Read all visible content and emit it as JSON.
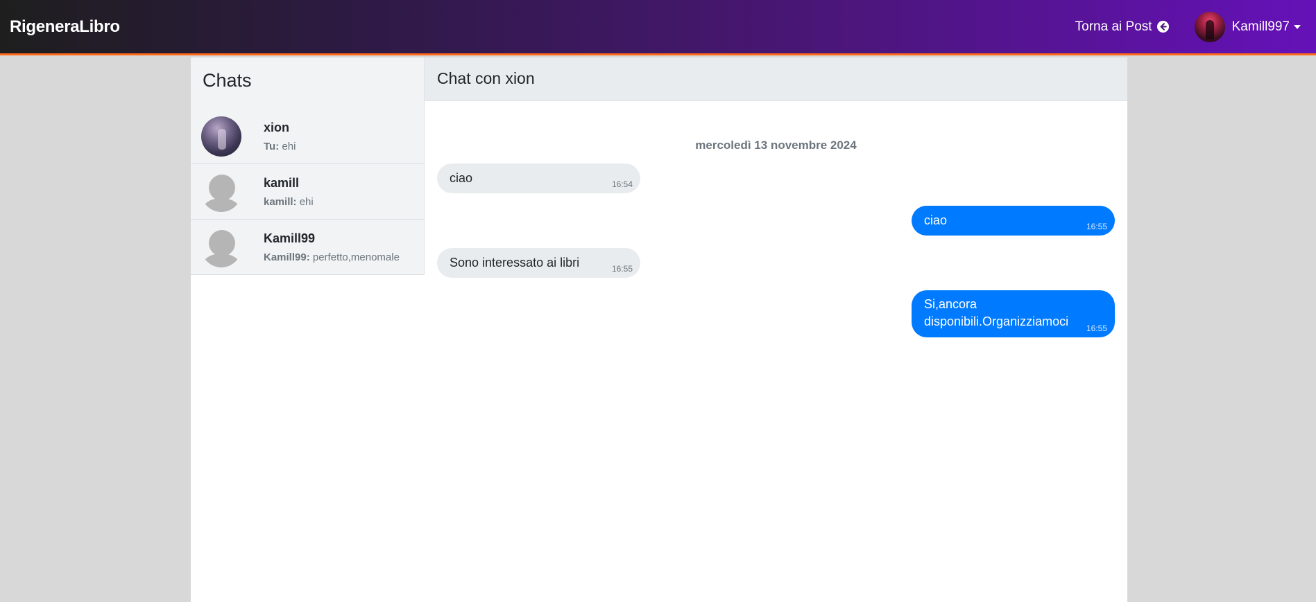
{
  "navbar": {
    "brand": "RigeneraLibro",
    "back_label": "Torna ai Post",
    "username": "Kamill997"
  },
  "sidebar": {
    "title": "Chats",
    "chats": [
      {
        "name": "xion",
        "sender": "Tu:",
        "preview": "ehi",
        "avatar": "photo"
      },
      {
        "name": "kamill",
        "sender": "kamill:",
        "preview": "ehi",
        "avatar": "default-user-icon"
      },
      {
        "name": "Kamill99",
        "sender": "Kamill99:",
        "preview": "perfetto,menomale",
        "avatar": "default-user-icon"
      }
    ]
  },
  "conversation": {
    "title": "Chat con xion",
    "date_separator": "mercoledì 13 novembre 2024",
    "messages": [
      {
        "direction": "incoming",
        "text": "ciao",
        "time": "16:54"
      },
      {
        "direction": "outgoing",
        "text": "ciao",
        "time": "16:55"
      },
      {
        "direction": "incoming",
        "text": "Sono interessato ai libri",
        "time": "16:55"
      },
      {
        "direction": "outgoing",
        "text_line1": "Si,ancora",
        "text_line2": "disponibili.Organizziamoci",
        "time": "16:55"
      }
    ]
  },
  "colors": {
    "accent_orange": "#ff6a1a",
    "outgoing_bubble": "#007bff",
    "incoming_bubble": "#e9ecef",
    "navbar_gradient_end": "#6511b8"
  }
}
